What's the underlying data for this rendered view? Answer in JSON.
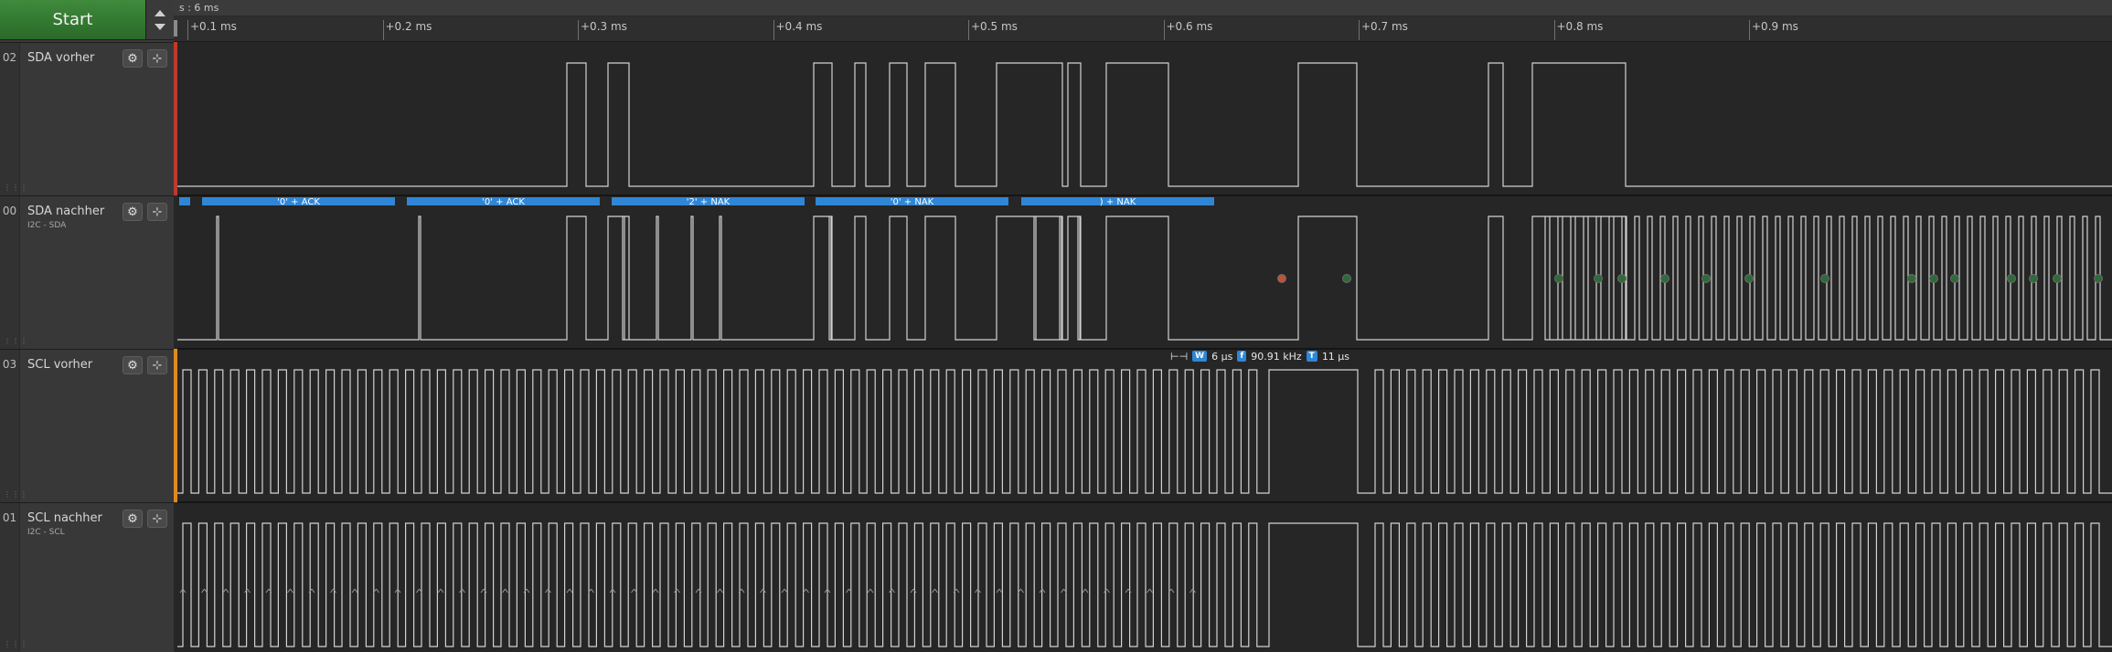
{
  "toolbar": {
    "start_label": "Start",
    "time_readout": "s : 6 ms"
  },
  "ruler": {
    "labels": [
      "+0.1 ms",
      "+0.2 ms",
      "+0.3 ms",
      "+0.4 ms",
      "+0.5 ms",
      "+0.6 ms",
      "+0.7 ms",
      "+0.8 ms",
      "+0.9 ms"
    ]
  },
  "channels": [
    {
      "number": "02",
      "name": "SDA vorher",
      "sub": "",
      "color": "#c0392b"
    },
    {
      "number": "00",
      "name": "SDA nachher",
      "sub": "I2C - SDA",
      "color": ""
    },
    {
      "number": "03",
      "name": "SCL vorher",
      "sub": "",
      "color": "#e08a1e"
    },
    {
      "number": "01",
      "name": "SCL nachher",
      "sub": "I2C - SCL",
      "color": ""
    }
  ],
  "icons": {
    "settings": "gear-icon",
    "add_analyzer": "add-trace-icon",
    "grip": "grip-icon",
    "measure": "width-measure-icon"
  },
  "decoded_frames": [
    {
      "label": "",
      "ch": 1
    },
    {
      "label": "'0' + ACK",
      "ch": 1
    },
    {
      "label": "'0' + ACK",
      "ch": 1
    },
    {
      "label": "'2' + NAK",
      "ch": 1
    },
    {
      "label": "'0' + NAK",
      "ch": 1
    },
    {
      "label": ") + NAK",
      "ch": 1
    }
  ],
  "measurement": {
    "width_badge": "W",
    "width_value": "6 µs",
    "freq_badge": "f",
    "freq_value": "90.91 kHz",
    "period_badge": "T",
    "period_value": "11 µs"
  },
  "colors": {
    "frame": "#2f86d6",
    "signal": "#d2d2d2",
    "dot_ok": "#2f6a3a",
    "dot_err": "#c0503a"
  }
}
